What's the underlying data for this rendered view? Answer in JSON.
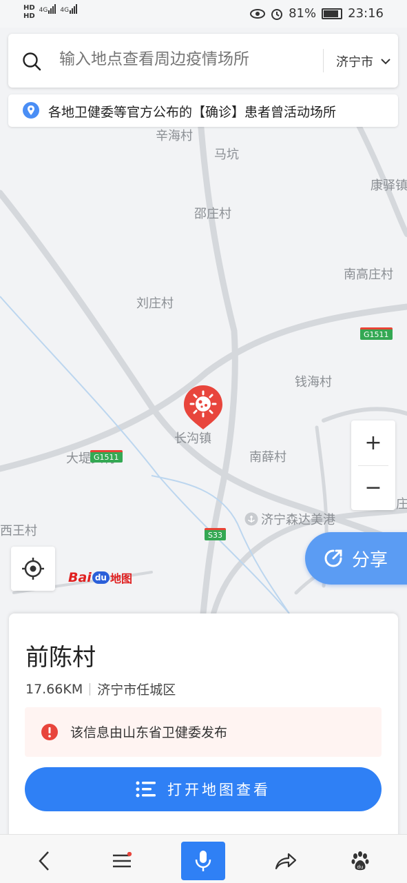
{
  "status_bar": {
    "hd1": "HD",
    "hd2": "HD",
    "net1": "4G",
    "net2": "4G",
    "battery_pct": "81%",
    "time": "23:16",
    "icons": [
      "eye-icon",
      "alarm-icon",
      "battery-icon"
    ]
  },
  "search": {
    "placeholder": "输入地点查看周边疫情场所",
    "city": "济宁市"
  },
  "notice": {
    "text": "各地卫健委等官方公布的【确诊】患者曾活动场所"
  },
  "map": {
    "places": {
      "xinhai": "辛海村",
      "makeng": "马坑",
      "kangyi": "康驿镇",
      "shaozhuang": "邵庄村",
      "nangaozhuang": "南高庄村",
      "liuzhuang": "刘庄村",
      "qianhai": "钱海村",
      "changgou": "长沟镇",
      "dadi": "大堤头村",
      "nanxue": "南薛村",
      "xiwang": "西王村",
      "port": "济宁森达美港",
      "partial_zhuang": "庄",
      "partial_zhen": "镇"
    },
    "highways": {
      "g1511_a": "G1511",
      "g1511_b": "G1511",
      "s33": "S33"
    },
    "zoom_in": "+",
    "zoom_out": "−",
    "share_label": "分享",
    "logo": {
      "bai": "Bai",
      "du": "du",
      "ditu": "地图"
    }
  },
  "card": {
    "title": "前陈村",
    "distance": "17.66KM",
    "region": "济宁市任城区",
    "warning": "该信息由山东省卫健委发布",
    "open_button": "打开地图查看"
  },
  "colors": {
    "accent": "#2f80f5",
    "marker": "#e8453c",
    "share": "#5b9cf3"
  }
}
